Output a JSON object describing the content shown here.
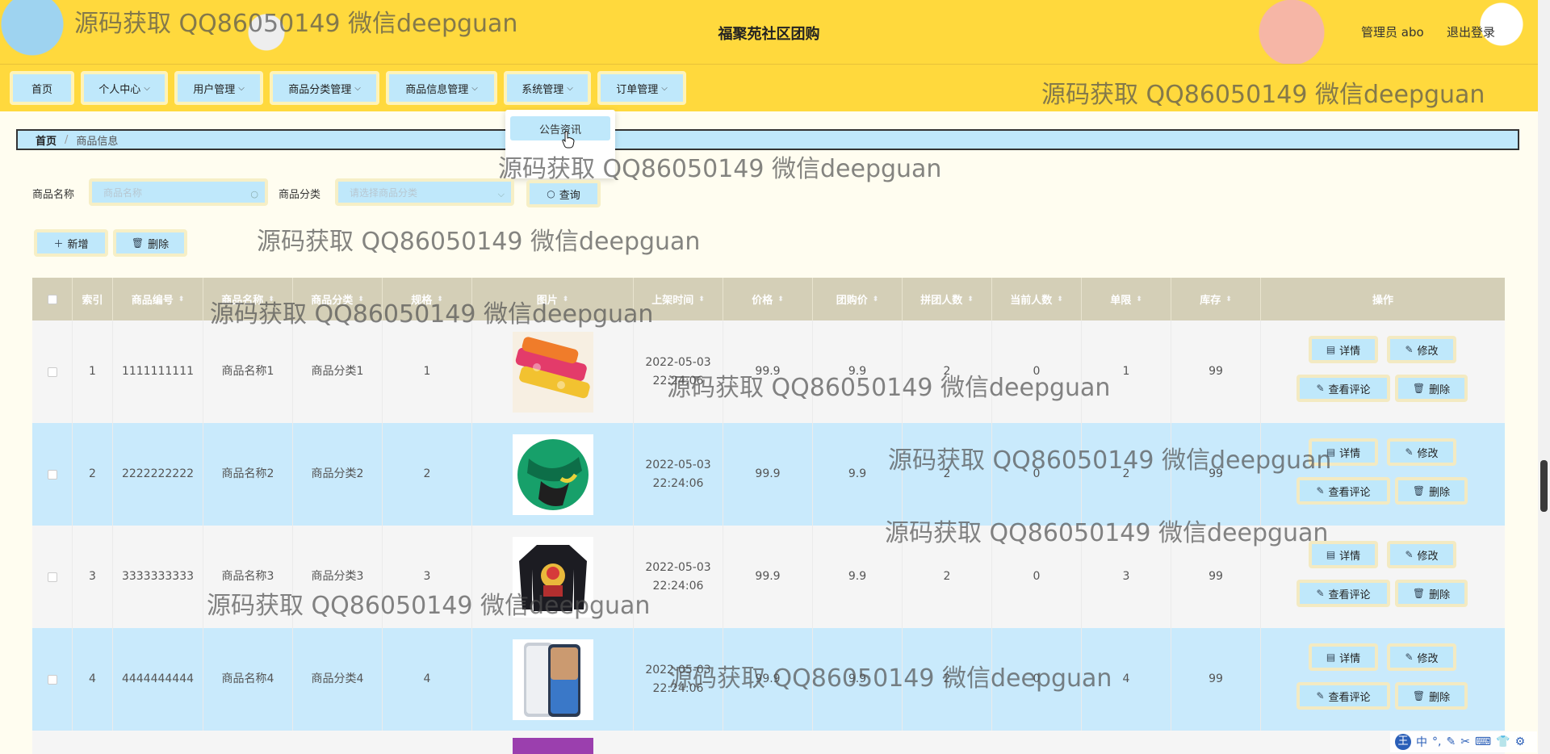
{
  "header": {
    "title": "福聚苑社区团购",
    "admin": "管理员 abo",
    "logout": "退出登录"
  },
  "nav": [
    {
      "label": "首页",
      "has_menu": false
    },
    {
      "label": "个人中心",
      "has_menu": true
    },
    {
      "label": "用户管理",
      "has_menu": true
    },
    {
      "label": "商品分类管理",
      "has_menu": true
    },
    {
      "label": "商品信息管理",
      "has_menu": true
    },
    {
      "label": "系统管理",
      "has_menu": true
    },
    {
      "label": "订单管理",
      "has_menu": true
    }
  ],
  "dropdown": {
    "item": "公告资讯"
  },
  "breadcrumb": {
    "home": "首页",
    "sep": "/",
    "current": "商品信息"
  },
  "search": {
    "name_label": "商品名称",
    "name_placeholder": "商品名称",
    "cat_label": "商品分类",
    "cat_placeholder": "请选择商品分类",
    "query_button": "查询"
  },
  "actions": {
    "add": "新增",
    "delete": "删除"
  },
  "table": {
    "headers": [
      "索引",
      "商品编号",
      "商品名称",
      "商品分类",
      "规格",
      "图片",
      "上架时间",
      "价格",
      "团购价",
      "拼团人数",
      "当前人数",
      "单限",
      "库存",
      "操作"
    ],
    "row_buttons": {
      "detail": "详情",
      "edit": "修改",
      "comments": "查看评论",
      "delete": "删除"
    },
    "rows": [
      {
        "index": "1",
        "code": "1111111111",
        "name": "商品名称1",
        "category": "商品分类1",
        "spec": "1",
        "date": "2022-05-03",
        "time": "22:24:06",
        "price": "99.9",
        "group_price": "9.9",
        "group_size": "2",
        "current": "0",
        "limit": "1",
        "stock": "99",
        "image": "snack-tubes"
      },
      {
        "index": "2",
        "code": "2222222222",
        "name": "商品名称2",
        "category": "商品分类2",
        "spec": "2",
        "date": "2022-05-03",
        "time": "22:24:06",
        "price": "99.9",
        "group_price": "9.9",
        "group_size": "2",
        "current": "0",
        "limit": "2",
        "stock": "99",
        "image": "soccer-ball"
      },
      {
        "index": "3",
        "code": "3333333333",
        "name": "商品名称3",
        "category": "商品分类3",
        "spec": "3",
        "date": "2022-05-03",
        "time": "22:24:06",
        "price": "99.9",
        "group_price": "9.9",
        "group_size": "2",
        "current": "0",
        "limit": "3",
        "stock": "99",
        "image": "sweatshirt"
      },
      {
        "index": "4",
        "code": "4444444444",
        "name": "商品名称4",
        "category": "商品分类4",
        "spec": "4",
        "date": "2022-05-03",
        "time": "22:24:06",
        "price": "99.9",
        "group_price": "9.9",
        "group_size": "2",
        "current": "0",
        "limit": "4",
        "stock": "99",
        "image": "smartphones"
      }
    ]
  },
  "watermark": "源码获取 QQ86050149 微信deepguan",
  "ime": {
    "label": "中"
  }
}
